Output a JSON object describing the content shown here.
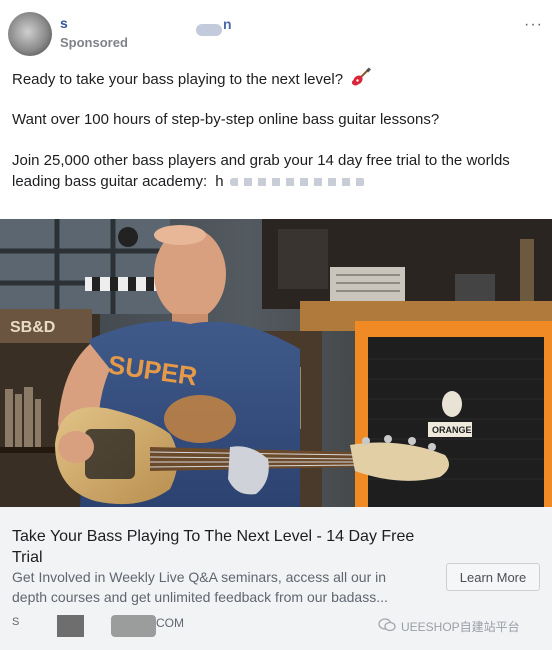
{
  "header": {
    "page_name_start": "s",
    "page_name_end": "n",
    "sponsored_label": "Sponsored",
    "more_label": "···"
  },
  "post": {
    "line1": "Ready to take your bass playing to the next level?",
    "line2": "Want over 100 hours of step-by-step online bass guitar lessons?",
    "line3": "Join 25,000 other bass players and grab your 14 day free trial to the worlds",
    "line4": "leading bass guitar academy:",
    "url_visible": "h"
  },
  "image": {
    "shirt_text": "SUPER",
    "sign_text": "SB&D",
    "amp_brand": "ORANGE"
  },
  "link_preview": {
    "title": "Take Your Bass Playing To The Next Level - 14 Day Free Trial",
    "description": "Get Involved in Weekly Live Q&A seminars, access all our in depth courses and get unlimited feedback from our badass...",
    "domain_start": "S",
    "domain_end": "COM",
    "cta_label": "Learn More"
  },
  "watermark": {
    "text": "UEESHOP自建站平台"
  },
  "colors": {
    "link_blue": "#365899",
    "muted_gray": "#606770",
    "link_box_bg": "#f2f3f5",
    "amp_orange": "#f08a24"
  }
}
